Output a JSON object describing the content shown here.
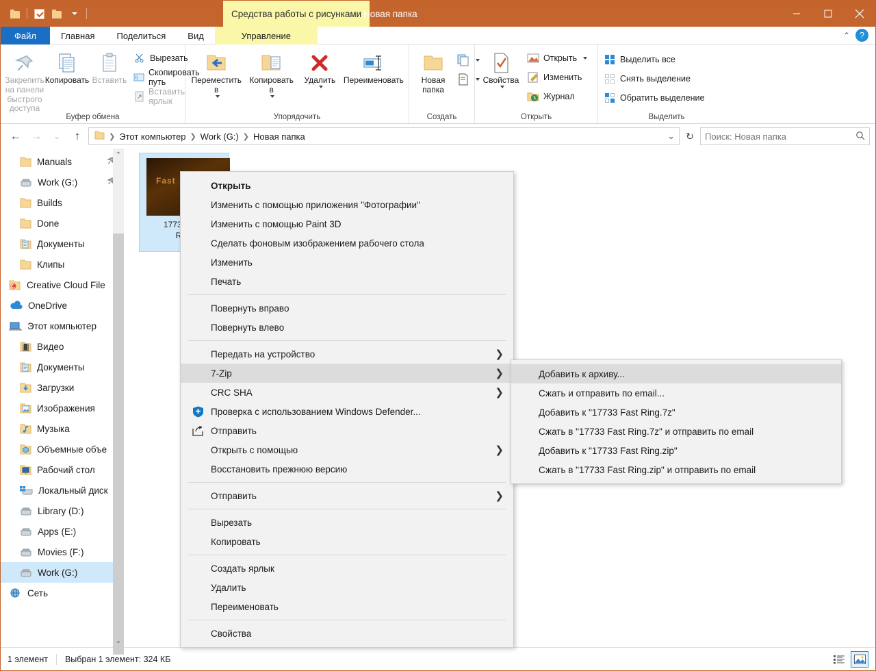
{
  "window": {
    "contextual_tab_header": "Средства работы с рисунками",
    "title": "Новая папка",
    "minimize": "—",
    "maximize": "□",
    "close": "✕"
  },
  "ribbon": {
    "tabs": [
      {
        "label": "Файл",
        "kind": "file"
      },
      {
        "label": "Главная",
        "kind": "normal"
      },
      {
        "label": "Поделиться",
        "kind": "normal"
      },
      {
        "label": "Вид",
        "kind": "normal"
      },
      {
        "label": "Управление",
        "kind": "contextual"
      }
    ],
    "collapse_icon": "chevron-up-icon",
    "help_icon": "?",
    "groups": [
      {
        "label": "Буфер обмена",
        "big": [
          {
            "label": "Закрепить на панели быстрого доступа",
            "icon": "pin-icon",
            "dim": true
          },
          {
            "label": "Копировать",
            "icon": "copy-icon",
            "dim": false
          },
          {
            "label": "Вставить",
            "icon": "paste-icon",
            "dim": true
          }
        ],
        "small": [
          {
            "label": "Вырезать",
            "icon": "scissors-icon",
            "dim": false
          },
          {
            "label": "Скопировать путь",
            "icon": "copy-path-icon",
            "dim": false
          },
          {
            "label": "Вставить ярлык",
            "icon": "paste-shortcut-icon",
            "dim": true
          }
        ]
      },
      {
        "label": "Упорядочить",
        "big": [
          {
            "label": "Переместить в",
            "icon": "move-to-icon",
            "dropdown": true
          },
          {
            "label": "Копировать в",
            "icon": "copy-to-icon",
            "dropdown": true
          },
          {
            "label": "Удалить",
            "icon": "delete-icon",
            "dropdown": true
          },
          {
            "label": "Переименовать",
            "icon": "rename-icon",
            "dropdown": false
          }
        ]
      },
      {
        "label": "Создать",
        "big": [
          {
            "label": "Новая папка",
            "icon": "new-folder-icon"
          }
        ],
        "small": [
          {
            "label": "",
            "icon": "new-item-icon",
            "dropdown": true
          },
          {
            "label": "",
            "icon": "easy-access-icon",
            "dropdown": true
          }
        ]
      },
      {
        "label": "Открыть",
        "big": [
          {
            "label": "Свойства",
            "icon": "properties-icon",
            "dropdown": true
          }
        ],
        "small": [
          {
            "label": "Открыть",
            "icon": "open-icon",
            "dropdown": true
          },
          {
            "label": "Изменить",
            "icon": "edit-icon",
            "dropdown": false
          },
          {
            "label": "Журнал",
            "icon": "history-icon",
            "dropdown": false
          }
        ]
      },
      {
        "label": "Выделить",
        "small": [
          {
            "label": "Выделить все",
            "icon": "select-all-icon"
          },
          {
            "label": "Снять выделение",
            "icon": "select-none-icon"
          },
          {
            "label": "Обратить выделение",
            "icon": "invert-selection-icon"
          }
        ]
      }
    ]
  },
  "addressbar": {
    "back_icon": "←",
    "forward_icon": "→",
    "recent_icon": "⌄",
    "up_icon": "↑",
    "breadcrumbs": [
      "Этот компьютер",
      "Work (G:)",
      "Новая папка"
    ],
    "dropdown_icon": "⌄",
    "refresh_icon": "↻",
    "search_placeholder": "Поиск: Новая папка",
    "search_value": "",
    "search_icon": "search-icon"
  },
  "sidebar": {
    "items": [
      {
        "label": "Manuals",
        "icon": "folder-icon",
        "indent": 2,
        "pinned": true
      },
      {
        "label": "Work (G:)",
        "icon": "drive-icon",
        "indent": 2,
        "pinned": true
      },
      {
        "label": "Builds",
        "icon": "folder-icon",
        "indent": 2
      },
      {
        "label": "Done",
        "icon": "folder-icon",
        "indent": 2
      },
      {
        "label": "Документы",
        "icon": "documents-folder-icon",
        "indent": 2
      },
      {
        "label": "Клипы",
        "icon": "folder-icon",
        "indent": 2
      },
      {
        "label": "Creative Cloud File",
        "icon": "creative-cloud-icon",
        "indent": 1
      },
      {
        "label": "OneDrive",
        "icon": "onedrive-icon",
        "indent": 1
      },
      {
        "label": "Этот компьютер",
        "icon": "this-pc-icon",
        "indent": 1
      },
      {
        "label": "Видео",
        "icon": "videos-folder-icon",
        "indent": 2
      },
      {
        "label": "Документы",
        "icon": "documents-folder-icon",
        "indent": 2
      },
      {
        "label": "Загрузки",
        "icon": "downloads-folder-icon",
        "indent": 2
      },
      {
        "label": "Изображения",
        "icon": "pictures-folder-icon",
        "indent": 2
      },
      {
        "label": "Музыка",
        "icon": "music-folder-icon",
        "indent": 2
      },
      {
        "label": "Объемные объе",
        "icon": "3d-objects-folder-icon",
        "indent": 2
      },
      {
        "label": "Рабочий стол",
        "icon": "desktop-folder-icon",
        "indent": 2
      },
      {
        "label": "Локальный диск",
        "icon": "system-drive-icon",
        "indent": 2
      },
      {
        "label": "Library (D:)",
        "icon": "drive-icon",
        "indent": 2
      },
      {
        "label": "Apps (E:)",
        "icon": "drive-icon",
        "indent": 2
      },
      {
        "label": "Movies (F:)",
        "icon": "drive-icon",
        "indent": 2
      },
      {
        "label": "Work (G:)",
        "icon": "drive-icon",
        "indent": 2,
        "selected": true
      },
      {
        "label": "Сеть",
        "icon": "network-icon",
        "indent": 1
      }
    ],
    "scroll_up_icon": "⌃",
    "scroll_down_icon": "⌄"
  },
  "file_tile": {
    "name_line1": "17733 Fast",
    "name_line2": "Ring",
    "thumb_text": "Fast"
  },
  "context_menu": {
    "items": [
      {
        "label": "Открыть",
        "bold": true
      },
      {
        "label": "Изменить с помощью приложения \"Фотографии\""
      },
      {
        "label": "Изменить с помощью Paint 3D"
      },
      {
        "label": "Сделать фоновым изображением рабочего стола"
      },
      {
        "label": "Изменить"
      },
      {
        "label": "Печать"
      },
      {
        "separator": true
      },
      {
        "label": "Повернуть вправо"
      },
      {
        "label": "Повернуть влево"
      },
      {
        "separator": true
      },
      {
        "label": "Передать на устройство",
        "submenu": true
      },
      {
        "label": "7-Zip",
        "submenu": true,
        "highlighted": true
      },
      {
        "label": "CRC SHA",
        "submenu": true
      },
      {
        "label": "Проверка с использованием Windows Defender...",
        "icon": "windows-defender-shield-icon"
      },
      {
        "label": "Отправить",
        "icon": "share-icon"
      },
      {
        "label": "Открыть с помощью",
        "submenu": true
      },
      {
        "label": "Восстановить прежнюю версию"
      },
      {
        "separator": true
      },
      {
        "label": "Отправить",
        "submenu": true
      },
      {
        "separator": true
      },
      {
        "label": "Вырезать"
      },
      {
        "label": "Копировать"
      },
      {
        "separator": true
      },
      {
        "label": "Создать ярлык"
      },
      {
        "label": "Удалить"
      },
      {
        "label": "Переименовать"
      },
      {
        "separator": true
      },
      {
        "label": "Свойства"
      }
    ]
  },
  "submenu_7zip": {
    "items": [
      {
        "label": "Добавить к архиву...",
        "highlighted": true
      },
      {
        "label": "Сжать и отправить по email..."
      },
      {
        "label": "Добавить к \"17733 Fast Ring.7z\""
      },
      {
        "label": "Сжать в \"17733 Fast Ring.7z\" и отправить по email"
      },
      {
        "label": "Добавить к \"17733 Fast Ring.zip\""
      },
      {
        "label": "Сжать в \"17733 Fast Ring.zip\" и отправить по email"
      }
    ]
  },
  "statusbar": {
    "item_count": "1 элемент",
    "selection_info": "Выбран 1 элемент: 324 КБ",
    "view_details_icon": "details-view-icon",
    "view_thumbnails_icon": "thumbnails-view-icon"
  },
  "colors": {
    "titlebar": "#c4652e",
    "contextual_tab": "#fbf7a8",
    "file_tab": "#1a6fc4",
    "selection": "#cfe8fa",
    "menu_bg": "#f2f2f2",
    "menu_highlight": "#dcdcdc"
  }
}
